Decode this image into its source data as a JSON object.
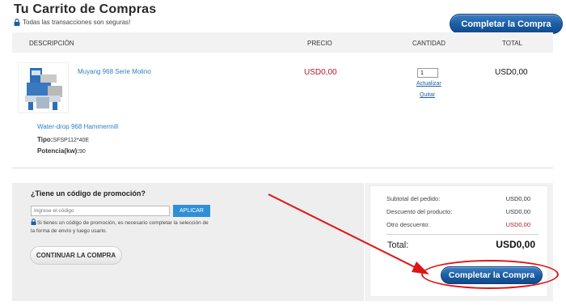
{
  "header": {
    "title": "Tu Carrito de Compras",
    "secure_note": "Todas las transacciones son seguras!",
    "checkout_label": "Completar la Compra"
  },
  "table": {
    "col_description": "DESCRIPCIÓN",
    "col_price": "PRECIO",
    "col_quantity": "CANTIDAD",
    "col_total": "TOTAL"
  },
  "item": {
    "name": "Muyang 968 Serie Molino",
    "price": "USD0,00",
    "quantity": "1",
    "update_label": "Actualizar",
    "remove_label": "Quitar",
    "total": "USD0,00",
    "variant": "Water-drop 968 Hammermill",
    "tipo_label": "Tipo:",
    "tipo_value": "SFSP112*40E",
    "potencia_label": "Potencia(kw):",
    "potencia_value": "90"
  },
  "promo": {
    "title": "¿Tiene un código de promoción?",
    "input_placeholder": "Ingrese el código",
    "apply_label": "APLICAR",
    "note": "Si tienes un código de promoción, es necesario completar la selección de la forma de envío y luego usarlo.",
    "continue_label": "CONTINUAR LA COMPRA"
  },
  "summary": {
    "subtotal_label": "Subtotal del pedido:",
    "subtotal_value": "USD0,00",
    "discount_label": "Descuento del producto:",
    "discount_value": "USD0,00",
    "other_label": "Otro descuento:",
    "other_value": "USD0,00",
    "total_label": "Total:",
    "total_value": "USD0,00",
    "checkout_label": "Completar la Compra"
  },
  "colors": {
    "accent_blue": "#1c5fa6",
    "link_blue": "#2f7fc4",
    "price_red": "#b01a2a",
    "annotation_red": "#e01414"
  }
}
